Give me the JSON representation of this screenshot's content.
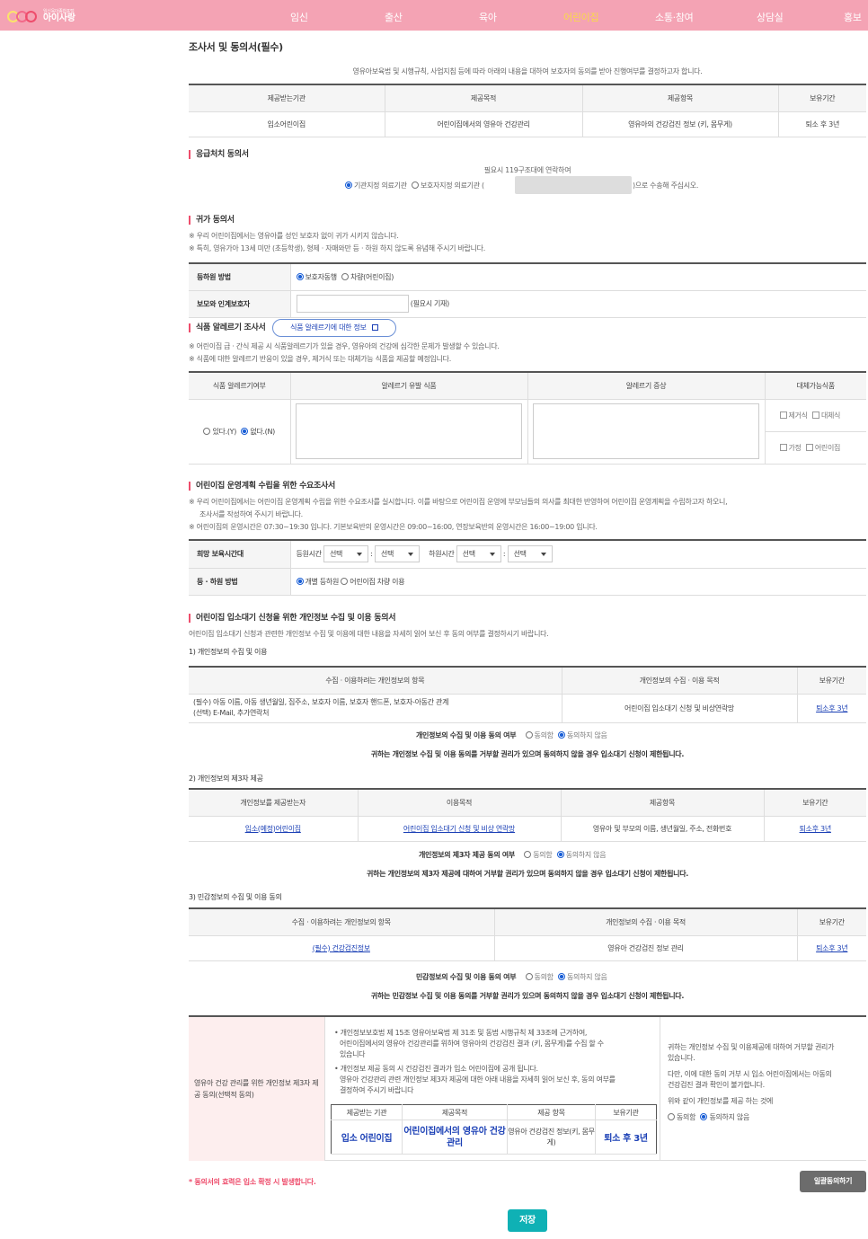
{
  "header": {
    "logo_small": "임신육아종합포털",
    "logo_big": "아이사랑",
    "nav": [
      "임신",
      "출산",
      "육아",
      "어린이집",
      "소통·참여",
      "상담실",
      "홍보"
    ]
  },
  "page_title": "조사서 및 동의서(필수)",
  "intro": "영유아보육법 및 시행규칙, 사업지침 등에 따라 아래의 내용을 대하여 보호자의 동의를 받아 진행여부를 결정하고자 합니다.",
  "table1": {
    "headers": [
      "제공받는기관",
      "제공목적",
      "제공항목",
      "보유기간"
    ],
    "row": [
      "입소어린이집",
      "어린이집에서의 영유아 건강관리",
      "영유아의 건강검진 정보 (키, 몸무게)",
      "퇴소 후 3년"
    ]
  },
  "emergency": {
    "title": "응급처치 동의서",
    "line1": "필요시 119구조대에 연락하여",
    "opt1": "기관지정 의료기관",
    "opt2": "보호자지정 의료기관 (",
    "suffix": ")으로 수송해 주십시오."
  },
  "home": {
    "title": "귀가 동의서",
    "note1": "※ 우리 어린이집에서는 영유아를 성인 보호자 없이 귀가 시키지 않습니다.",
    "note2": "※ 특히, 영유가아 13세 미만 (초등학생), 형제 · 자매와만 등 · 하원 하지 않도록 유념해 주시기 바랍니다.",
    "row1_label": "등하원 방법",
    "row1_opt1": "보호자동행",
    "row1_opt2": "차량(어린이집)",
    "row2_label": "보모와 인계보호자",
    "row2_hint": "(필요시 기재)"
  },
  "allergy": {
    "title": "식품 알레르기 조사서",
    "info_button": "식품 알레르기에 대한 정보",
    "note1": "※ 어린이집 급 · 간식 제공 시 식품알레르기가 있을 경우, 영유아의 건강에 심각한 문제가 발생할 수 있습니다.",
    "note2": "※ 식품에 대한 알레르기 반응이 있을 경우, 제거식 또는 대체가능 식품을 제공할 예정입니다.",
    "headers": [
      "식품 알레르기여부",
      "알레르기 유발 식품",
      "알레르기 증상",
      "대체가능식품"
    ],
    "opt_yes": "있다.(Y)",
    "opt_no": "없다.(N)",
    "chk1": "제거식",
    "chk2": "대체식",
    "chk3": "가정",
    "chk4": "어린이집"
  },
  "survey": {
    "title": "어린이집 운영계획 수립을 위한 수요조사서",
    "note1": "※ 우리 어린이집에서는 어린이집 운영계획 수립을 위한 수요조사를 실시합니다. 이를 바탕으로 어린이집 운영에 부모님들의 의사를 최대한 반영하여 어린이집 운영계획을 수립하고자 하오니,",
    "note1b": "조사서를 작성하여 주시기 바랍니다.",
    "note2": "※ 어린이집의 운영시간은 07:30~19:30 입니다. 기본보육반의 운영시간은 09:00~16:00, 연장보육반의 운영시간은 16:00~19:00 입니다.",
    "row1_label": "희망 보육시간대",
    "in_label": "등원시간",
    "out_label": "하원시간",
    "select": "선택",
    "colon": ":",
    "row2_label": "등 · 하원 방법",
    "row2_opt1": "개별 등하원",
    "row2_opt2": "어린이집 차량 이용"
  },
  "privacy": {
    "title": "어린이집 입소대기 신청을 위한 개인정보 수집 및 이용 동의서",
    "note": "어린이집 입소대기 신청과 관련한 개인정보 수집 및 이용에 대한 내용을 자세히 읽어 보신 후 동의 여부를 결정하시기 바랍니다.",
    "sub1": "1) 개인정보의 수집 및 이용",
    "t1_headers": [
      "수집 · 이용하려는 개인정보의 항목",
      "개인정보의 수집 · 이용 목적",
      "보유기간"
    ],
    "t1_item1": "(필수) 아동 이름, 아동 생년월일, 집주소, 보호자 이름, 보호자 핸드폰, 보호자-아동간 관계",
    "t1_item2": "(선택) E-Mail, 추가연락처",
    "t1_purpose": "어린이집 입소대기 신청 및 비상연락망",
    "t1_period": "퇴소후 3년",
    "c1_label": "개인정보의 수집 및 이용 동의 여부",
    "agree": "동의함",
    "disagree": "동의하지 않음",
    "c1_warn": "귀하는 개인정보 수집 및 이용 동의를 거부할 권리가 있으며 동의하지 않을 경우 입소대기 신청이 제한됩니다.",
    "sub2": "2) 개인정보의 제3자 제공",
    "t2_headers": [
      "개인정보를 제공받는자",
      "이용목적",
      "제공항목",
      "보유기간"
    ],
    "t2_row": [
      "입소(예정)어린이집",
      "어린이집 입소대기 신청 및 비상 연락망",
      "영유아 및 부모의 이름, 생년월일, 주소, 전화번호",
      "퇴소후 3년"
    ],
    "c2_label": "개인정보의 제3자 제공 동의 여부",
    "c2_warn": "귀하는 개인정보의 제3자 제공에 대하여 거부할 권리가 있으며 동의하지 않을 경우 입소대기 신청이 제한됩니다.",
    "sub3": "3) 민감정보의 수집 및 이용 동의",
    "t3_headers": [
      "수집 · 이용하려는 개인정보의 항목",
      "개인정보의 수집 · 이용 목적",
      "보유기간"
    ],
    "t3_row": [
      "(필수) 건강검진정보",
      "영유아 건강검진 정보 관리",
      "퇴소후 3년"
    ],
    "c3_label": "민감정보의 수집 및 이용 동의 여부",
    "c3_warn": "귀하는 민감정보 수집 및 이용 동의를 거부할 권리가 있으며 동의하지 않을 경우 입소대기 신청이 제한됩니다."
  },
  "health": {
    "left_label": "영유아 건강 관리를 위한 개인정보 제3자 제공 동의(선택적 동의)",
    "bullet1a": "• 개인정보보호법 제 15조 영유아보육법 제 31조 및 동법 시행규칙 제 33조에 근거하여,",
    "bullet1b": "어린이집에서의 영유아 건강관리를 위하여 영유아의 건강검진 결과 (키, 몸무게)를 수집 할 수",
    "bullet1c": "있습니다",
    "bullet2a": "• 개인정보 제공 동의 시 건강검진 결과가 입소 어린이집에 공개 됩니다.",
    "bullet2b": "영유아 건강관리 관련 개인정보 제3자 제공에 대한 아래 내용을 자세히 읽어 보신 후, 동의 여부를",
    "bullet2c": "결정하여 주시기 바랍니다",
    "inner_headers": [
      "제공받는 기관",
      "제공목적",
      "제공 항목",
      "보유기관"
    ],
    "inner_row": [
      "입소 어린이집",
      "어린이집에서의 영유아 건강 관리",
      "영유아 건강검진 정보(키, 몸무게)",
      "퇴소 후 3년"
    ],
    "right1a": "귀하는 개인정보 수집 및 이용제공에 대하여 거부할 권리가",
    "right1b": "있습니다.",
    "right2a": "다만, 이에 대한 동의 거부 시 입소 어린이집에서는 아동의",
    "right2b": "건강검진 결과 확인이 불가합니다.",
    "right3": "위와 같이 개인정보를 제공 하는 것에",
    "agree": "동의함",
    "disagree": "동의하지 않음"
  },
  "footer": {
    "notice": "* 동의서의 효력은 입소 확정 시 발생합니다.",
    "bulk_button": "일괄동의하기",
    "save_button": "저장"
  },
  "colors": {
    "header_pink": "#f4a3b4",
    "accent_red": "#ee4d6c",
    "save_teal": "#0fb1b5",
    "link_blue": "#1a3fb5"
  }
}
